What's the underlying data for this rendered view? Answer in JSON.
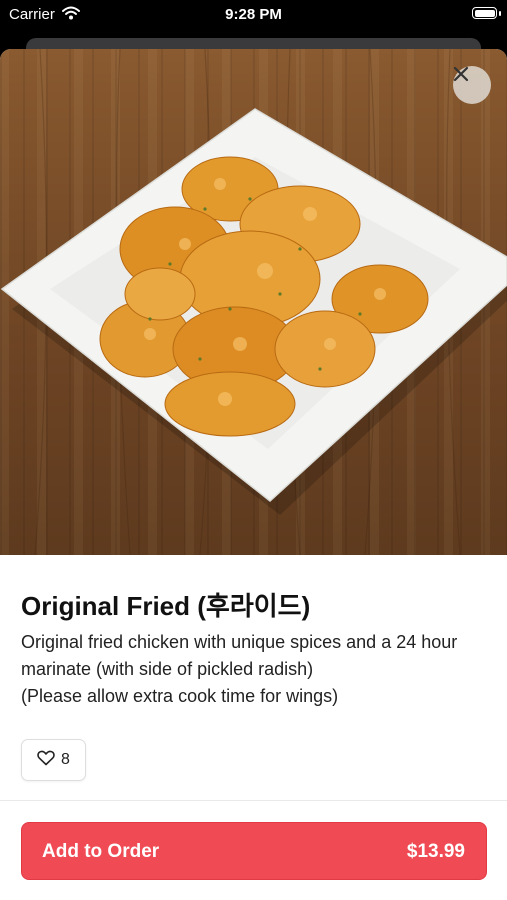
{
  "status_bar": {
    "carrier": "Carrier",
    "time": "9:28 PM"
  },
  "item": {
    "title": "Original Fried (후라이드)",
    "description": "Original fried chicken with unique spices and a 24 hour marinate (with side of pickled radish)\n(Please allow extra cook time for wings)",
    "likes": "8",
    "image_subject": "fried chicken on a white plate on a wooden table"
  },
  "order_button": {
    "label": "Add to Order",
    "price": "$13.99"
  },
  "icons": {
    "close": "close-icon",
    "like": "heart-icon",
    "wifi": "wifi-icon",
    "battery": "battery-icon"
  },
  "colors": {
    "accent": "#f04b55",
    "title_text": "#111111"
  }
}
